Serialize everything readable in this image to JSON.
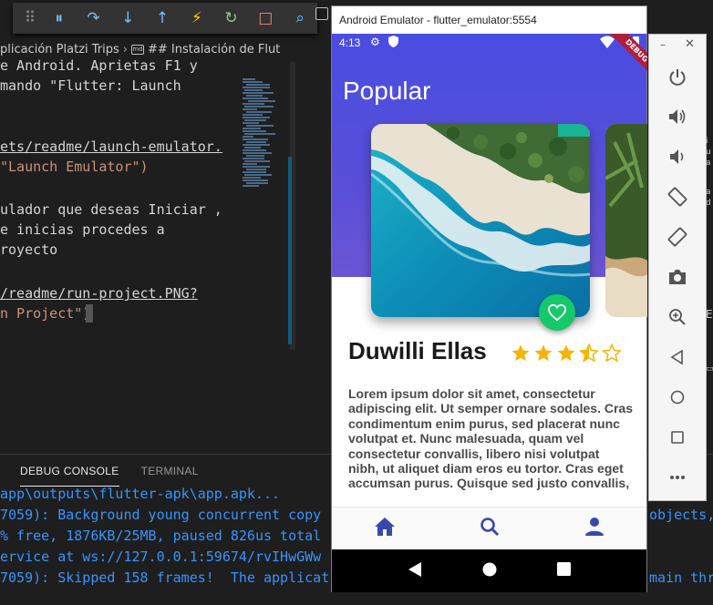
{
  "editor": {
    "breadcrumb": {
      "folder": "plicación Platzi Trips",
      "file_icon": "md",
      "heading": "## Instalación de Flut"
    },
    "lines": [
      {
        "text": "e Android. Aprietas F1 y",
        "style": "plain"
      },
      {
        "text": "mando \"Flutter: Launch",
        "style": "plain"
      },
      {
        "text": "",
        "style": "plain"
      },
      {
        "text": "ets/readme/launch-emulator.",
        "style": "link"
      },
      {
        "text": "\"Launch Emulator\")",
        "style": "str"
      },
      {
        "text": "",
        "style": "plain"
      },
      {
        "text": "ulador que deseas Iniciar ,",
        "style": "plain"
      },
      {
        "text": "e inicias procedes a",
        "style": "plain"
      },
      {
        "text": "royecto",
        "style": "plain"
      },
      {
        "text": "",
        "style": "plain"
      },
      {
        "text": "/readme/run-project.PNG?",
        "style": "link"
      },
      {
        "text": "n Project\")",
        "style": "str"
      }
    ]
  },
  "debug_toolbar": {
    "buttons": [
      {
        "name": "drag-handle-icon",
        "glyph": "⠿",
        "color": "#8a8a8a"
      },
      {
        "name": "pause-icon",
        "glyph": "⏸",
        "color": "#75beff"
      },
      {
        "name": "step-over-icon",
        "glyph": "↷",
        "color": "#75beff"
      },
      {
        "name": "step-into-icon",
        "glyph": "↓",
        "color": "#75beff"
      },
      {
        "name": "step-out-icon",
        "glyph": "↑",
        "color": "#75beff"
      },
      {
        "name": "hot-reload-icon",
        "glyph": "⚡",
        "color": "#ffcc00"
      },
      {
        "name": "restart-icon",
        "glyph": "↻",
        "color": "#89d185"
      },
      {
        "name": "stop-icon",
        "glyph": "□",
        "color": "#f48771"
      },
      {
        "name": "devtools-icon",
        "glyph": "⌕",
        "color": "#4fc1ff"
      }
    ]
  },
  "panel": {
    "tabs": [
      {
        "label": "DEBUG CONSOLE",
        "active": true
      },
      {
        "label": "TERMINAL",
        "active": false
      }
    ],
    "console_lines": [
      {
        "text": "app\\outputs\\flutter-apk\\app.apk...",
        "right": ""
      },
      {
        "text": "7059): Background young concurrent copy",
        "right": "objects,"
      },
      {
        "text": "% free, 1876KB/25MB, paused 826us total",
        "right": ""
      },
      {
        "text": "ervice at ws://127.0.0.1:59674/rvIHwGWw",
        "right": ""
      },
      {
        "text": "7059): Skipped 158 frames!  The applicat",
        "right": "main thr"
      }
    ]
  },
  "emulator": {
    "window_title": "Android Emulator - flutter_emulator:5554",
    "status_time": "4:13",
    "debug_banner": "DEBUG",
    "app_title": "Popular",
    "place_name": "Duwilli Ellas",
    "rating": 3.5,
    "rating_max": 5,
    "description": "Lorem ipsum dolor sit amet, consectetur adipiscing elit. Ut semper ornare sodales. Cras condimentum enim purus, sed placerat nunc volutpat et. Nunc malesuada, quam vel consectetur convallis, libero nisi volutpat nibh, ut aliquet diam eros eu tortor. Cras eget accumsan purus. Quisque sed justo convallis,",
    "bottom_nav": [
      "home-icon",
      "search-icon",
      "person-icon"
    ],
    "android_nav": [
      "back-icon",
      "home-circle-icon",
      "recents-icon"
    ],
    "controls": [
      "power-icon",
      "volume-up-icon",
      "volume-down-icon",
      "rotate-left-icon",
      "rotate-right-icon",
      "camera-icon",
      "zoom-icon",
      "back-icon",
      "home-icon",
      "overview-icon",
      "more-icon"
    ],
    "accent_colors": {
      "app_bar": "#4a4de0",
      "fab": "#14c96a",
      "star": "#f4b400",
      "nav_icon": "#3949ab"
    }
  }
}
